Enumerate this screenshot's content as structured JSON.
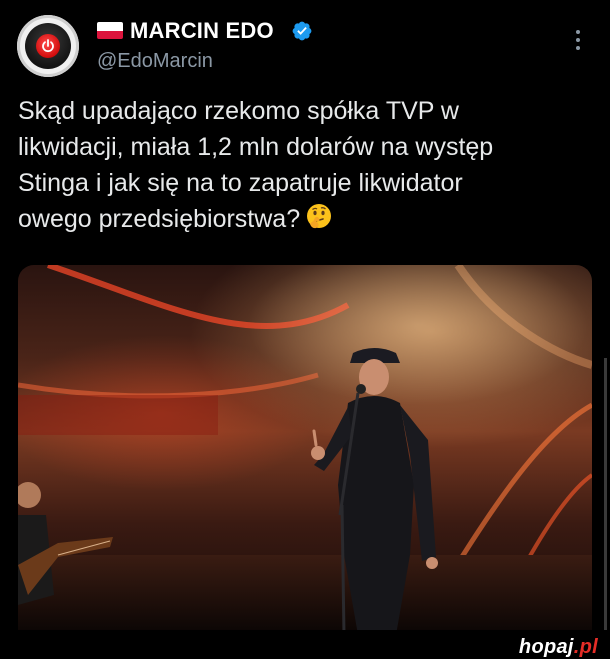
{
  "author": {
    "name": "MARCIN EDO",
    "handle": "@EdoMarcin",
    "verified": true,
    "flag": "poland-flag-icon",
    "avatar_icon": "power-button-icon"
  },
  "tweet": {
    "text": "Skąd upadająco rzekomo spółka TVP w\nlikwidacji, miała 1,2 mln dolarów na występ\nStinga i jak się na to zapatruje likwidator\nowego przedsiębiorstwa?"
  },
  "media": {
    "icon": "concert-photo"
  },
  "watermark": {
    "brand": "hopaj",
    "tld": ".pl"
  },
  "colors": {
    "background": "#000000",
    "text": "#e7e9ea",
    "muted": "#8b98a5",
    "verified": "#1d9bf0",
    "accent": "#e52d27"
  }
}
